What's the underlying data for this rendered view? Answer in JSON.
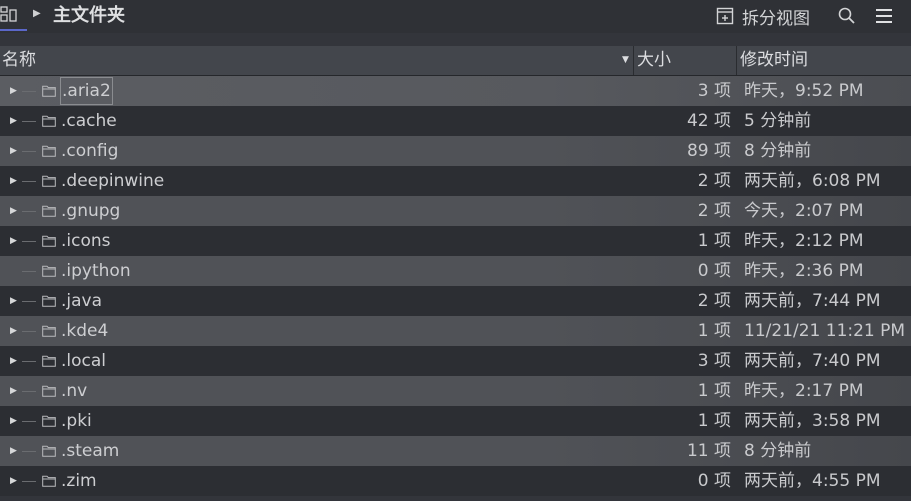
{
  "toolbar": {
    "title": "主文件夹",
    "split_view_label": "拆分视图",
    "icons": [
      "view-mode-icon",
      "chevron-right-icon",
      "split-view-icon",
      "search-icon",
      "hamburger-menu-icon"
    ]
  },
  "columns": {
    "name": "名称",
    "size": "大小",
    "modified": "修改时间"
  },
  "files": [
    {
      "name": ".aria2",
      "size": "3 项",
      "modified": "昨天，9:52 PM",
      "expandable": true
    },
    {
      "name": ".cache",
      "size": "42 项",
      "modified": "5 分钟前",
      "expandable": true
    },
    {
      "name": ".config",
      "size": "89 项",
      "modified": "8 分钟前",
      "expandable": true
    },
    {
      "name": ".deepinwine",
      "size": "2 项",
      "modified": "两天前，6:08 PM",
      "expandable": true
    },
    {
      "name": ".gnupg",
      "size": "2 项",
      "modified": "今天，2:07 PM",
      "expandable": true
    },
    {
      "name": ".icons",
      "size": "1 项",
      "modified": "昨天，2:12 PM",
      "expandable": true
    },
    {
      "name": ".ipython",
      "size": "0 项",
      "modified": "昨天，2:36 PM",
      "expandable": false
    },
    {
      "name": ".java",
      "size": "2 项",
      "modified": "两天前，7:44 PM",
      "expandable": true
    },
    {
      "name": ".kde4",
      "size": "1 项",
      "modified": "11/21/21 11:21 PM",
      "expandable": true
    },
    {
      "name": ".local",
      "size": "3 项",
      "modified": "两天前，7:40 PM",
      "expandable": true
    },
    {
      "name": ".nv",
      "size": "1 项",
      "modified": "昨天，2:17 PM",
      "expandable": true
    },
    {
      "name": ".pki",
      "size": "1 项",
      "modified": "两天前，3:58 PM",
      "expandable": true
    },
    {
      "name": ".steam",
      "size": "11 项",
      "modified": "8 分钟前",
      "expandable": true
    },
    {
      "name": ".zim",
      "size": "0 项",
      "modified": "两天前，4:55 PM",
      "expandable": true
    }
  ],
  "colors": {
    "accent": "#5b67c9",
    "background": "#33353b",
    "header": "#43464c"
  }
}
